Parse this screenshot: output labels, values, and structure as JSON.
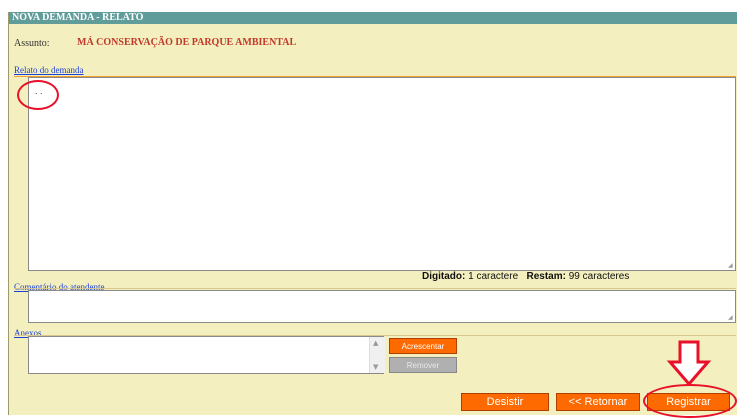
{
  "window": {
    "title": "NOVA DEMANDA - RELATO"
  },
  "assunto": {
    "label": "Assunto:",
    "value": "MÁ CONSERVAÇÃO DE PARQUE AMBIENTAL"
  },
  "relato": {
    "label": "Relato do demanda",
    "value": ". ."
  },
  "counter": {
    "typed_label": "Digitado:",
    "typed_value": "1 caractere",
    "remaining_label": "Restam:",
    "remaining_value": "99 caracteres"
  },
  "comentario": {
    "label": "Comentário do atendente",
    "value": ""
  },
  "anexos": {
    "label": "Anexos",
    "add_label": "Acrescentar",
    "remove_label": "Remover"
  },
  "actions": {
    "desistir": "Desistir",
    "retornar": "<< Retornar",
    "registrar": "Registrar"
  },
  "colors": {
    "panel_bg": "#f3efbe",
    "titlebar": "#5f9c9a",
    "accent_orange": "#ff6a00",
    "annotation_red": "#e8102a",
    "label_blue": "#1a3fd8",
    "assunto_red": "#c0392b"
  }
}
